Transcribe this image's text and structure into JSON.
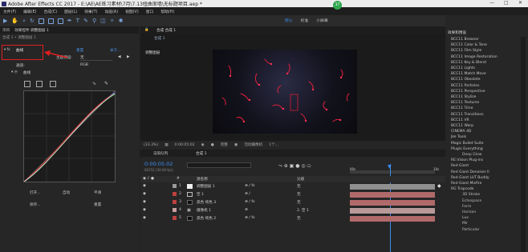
{
  "window": {
    "title": "Adobe After Effects CC 2017 - E:\\AE\\AE练习素材\\7月\\7.13扭曲渐墙\\无标题项目.aep *",
    "badge": "37",
    "controls": [
      "—",
      "□",
      "✕"
    ]
  },
  "menu": [
    "文件(F)",
    "编辑(E)",
    "合成(C)",
    "图层(L)",
    "效果(T)",
    "动画(A)",
    "视图(V)",
    "窗口",
    "帮助(H)"
  ],
  "workspaces": [
    "默认",
    "标准",
    "小屏幕"
  ],
  "search": {
    "placeholder": "搜索帮助"
  },
  "left_panel": {
    "tabs": [
      "项目",
      "效果控件 调整图层 1"
    ],
    "breadcrumb": "合成 1 • 调整图层 1",
    "effect_name": "曲线",
    "reset": "重置",
    "about": "关于...",
    "channel_label": "主题预设:",
    "channel_value": "无",
    "rgb_value": "RGB",
    "channel2_label": "通道:",
    "curves_label": "曲线",
    "buttons_row1": [
      "打开...",
      "自动",
      "平滑"
    ],
    "buttons_row2": [
      "保存...",
      "重置"
    ]
  },
  "comp_panel": {
    "tab": "合成 合成 1",
    "subtab": "合成 1",
    "layer_tag": "调整图层"
  },
  "viewer_bar": {
    "zoom": "(33.3%)",
    "timecode": "0:00:05:02",
    "quality": "完整",
    "camera": "活动摄像机",
    "views": "1个..."
  },
  "timeline": {
    "tab": "渲染队列",
    "comp_tab": "合成 1",
    "timecode": "0:00:05:02",
    "frames": "00152 (30.00 fps)",
    "col_source": "源名称",
    "col_parent": "父级",
    "ruler": [
      "00s",
      "10s"
    ],
    "layers": [
      {
        "num": "1",
        "name": "调整图层 1",
        "parent": "无",
        "color": "#9a9a9a"
      },
      {
        "num": "2",
        "name": "空 1",
        "parent": "无",
        "color": "#c04040"
      },
      {
        "num": "3",
        "name": "黑色 纯色 3",
        "parent": "无",
        "color": "#c04040"
      },
      {
        "num": "4",
        "name": "摄像机 1",
        "parent": "2. 空 1",
        "color": "#c9a0a0"
      },
      {
        "num": "5",
        "name": "黑色 纯色 2",
        "parent": "无",
        "color": "#c04040"
      }
    ]
  },
  "effects_panel": {
    "tab": "效果和预设",
    "items": [
      "BCC11 Browser",
      "BCC11 Color & Tone",
      "BCC11 Film Style",
      "BCC11 Image Restoration",
      "BCC11 Key & Blend",
      "BCC11 Lights",
      "BCC11 Match Move",
      "BCC11 Obsolete",
      "BCC11 Particles",
      "BCC11 Perspective",
      "BCC11 Stylize",
      "BCC11 Textures",
      "BCC11 Time",
      "BCC11 Transitions",
      "BCC11 VR",
      "BCC11 Warp",
      "CINEMA 4D",
      "Jke Tools",
      "Magic Bullet Suite",
      "Plugin Everything"
    ],
    "sub1": [
      "Deep Glow"
    ],
    "items2": [
      "RE:Vision Plug-ins",
      "Red Giant",
      "Red Giant Denoiser II",
      "Red Giant LUT Buddy",
      "Red Giant Misfire",
      "RG Trapcode"
    ],
    "sub2": [
      "3D Stroke",
      "Echospace",
      "Form",
      "Horizon",
      "Lux",
      "Mir",
      "Particular"
    ]
  }
}
